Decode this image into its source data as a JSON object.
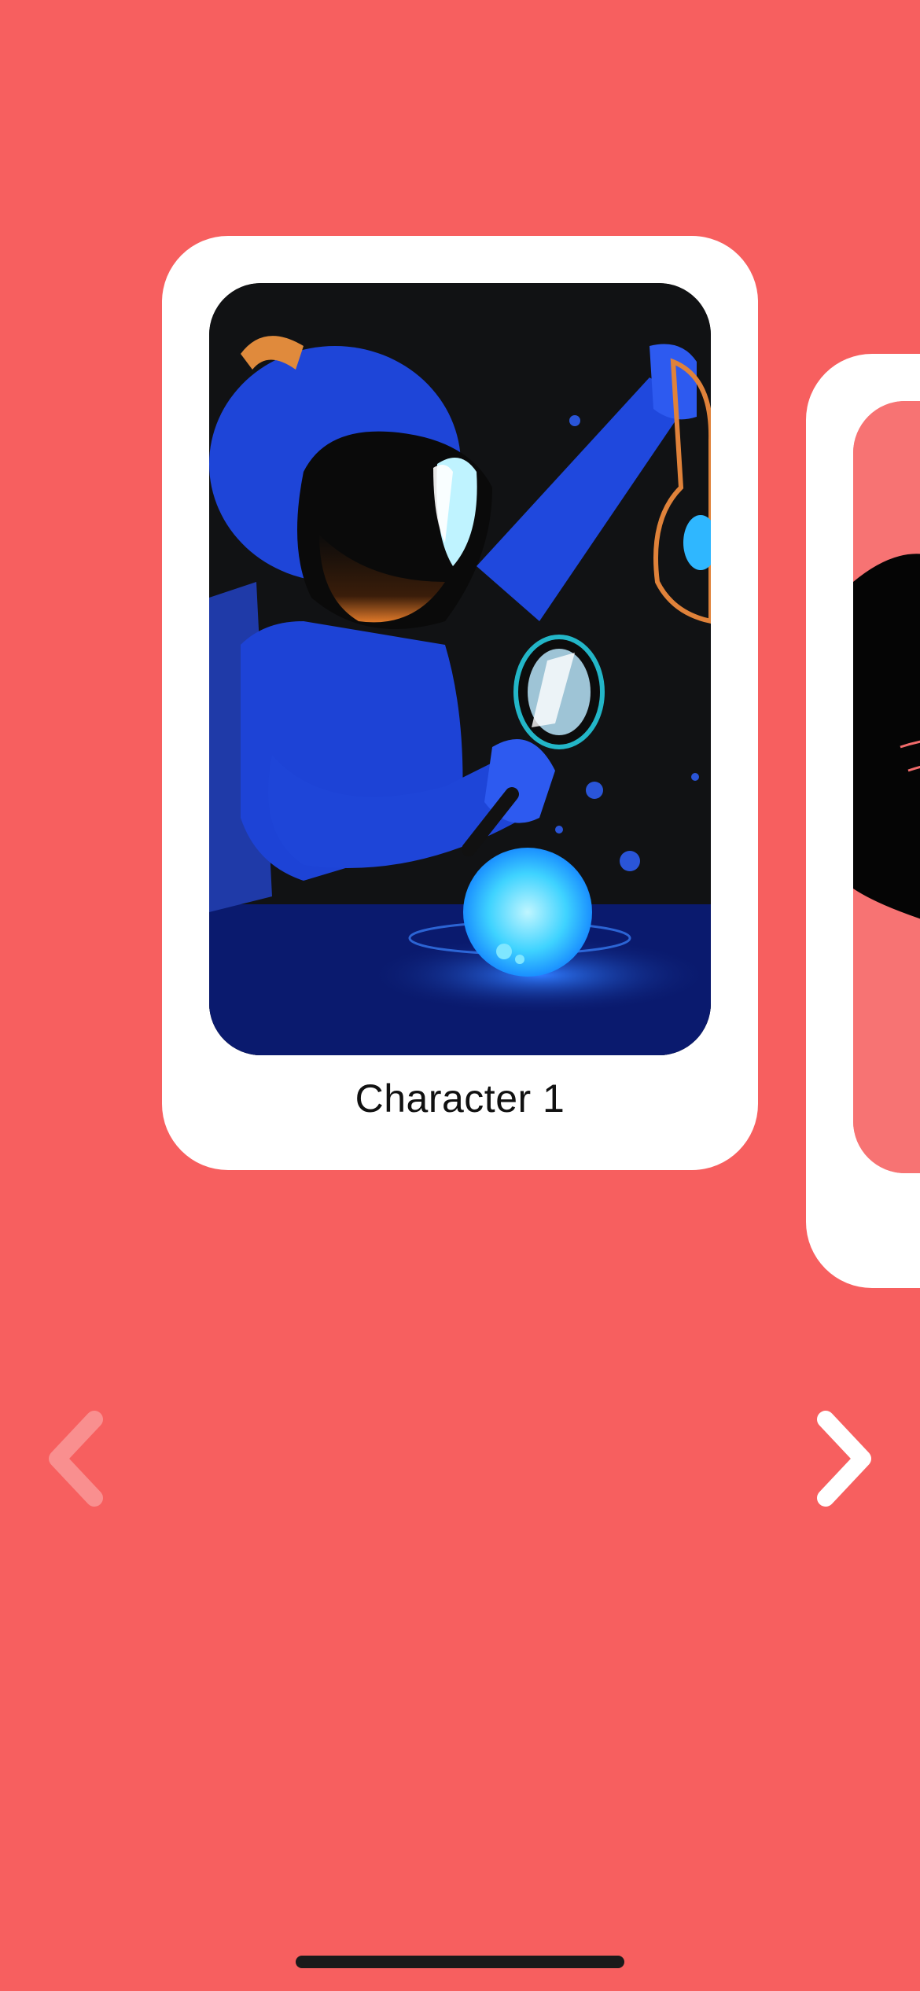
{
  "carousel": {
    "current_card": {
      "title": "Character 1",
      "artwork_icon": "astronaut-scientist-illustration"
    },
    "next_card": {
      "artwork_icon": "panther-illustration"
    },
    "prev_button": {
      "icon": "chevron-left-icon",
      "enabled": false
    },
    "next_button": {
      "icon": "chevron-right-icon",
      "enabled": true
    }
  },
  "colors": {
    "background": "#f75f5f",
    "card": "#ffffff",
    "next_card_artwork": "#f77373",
    "text": "#111111"
  }
}
